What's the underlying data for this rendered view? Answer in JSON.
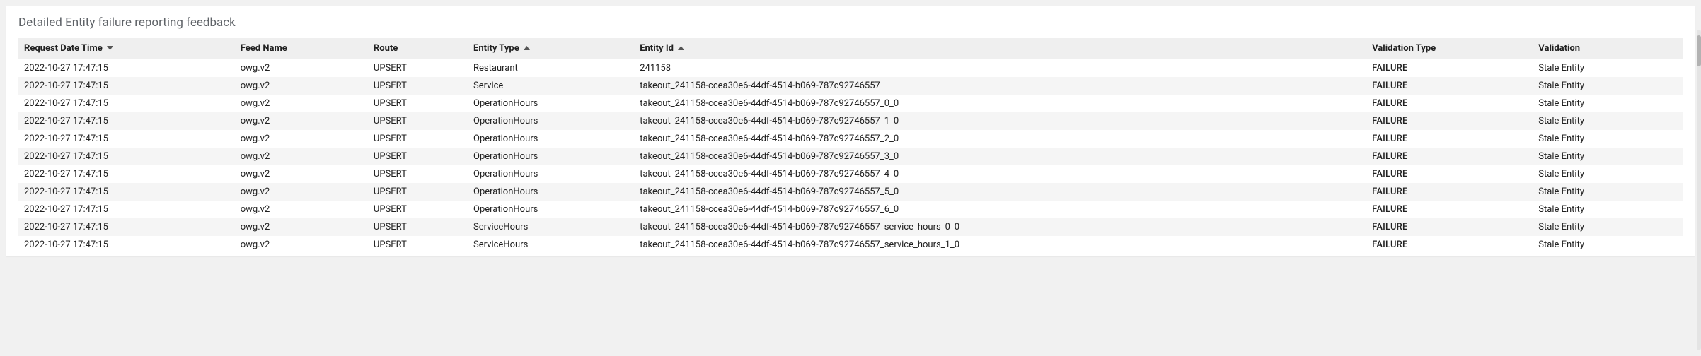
{
  "title": "Detailed Entity failure reporting feedback",
  "columns": {
    "request_date_time": "Request Date Time",
    "feed_name": "Feed Name",
    "route": "Route",
    "entity_type": "Entity Type",
    "entity_id": "Entity Id",
    "validation_type": "Validation Type",
    "validation": "Validation"
  },
  "sort": {
    "request_date_time": "desc",
    "entity_type": "asc",
    "entity_id": "asc"
  },
  "failure_style_label": "FAILURE",
  "rows": [
    {
      "request_date_time": "2022-10-27 17:47:15",
      "feed_name": "owg.v2",
      "route": "UPSERT",
      "entity_type": "Restaurant",
      "entity_id": "241158",
      "validation_type": "FAILURE",
      "validation": "Stale Entity"
    },
    {
      "request_date_time": "2022-10-27 17:47:15",
      "feed_name": "owg.v2",
      "route": "UPSERT",
      "entity_type": "Service",
      "entity_id": "takeout_241158-ccea30e6-44df-4514-b069-787c92746557",
      "validation_type": "FAILURE",
      "validation": "Stale Entity"
    },
    {
      "request_date_time": "2022-10-27 17:47:15",
      "feed_name": "owg.v2",
      "route": "UPSERT",
      "entity_type": "OperationHours",
      "entity_id": "takeout_241158-ccea30e6-44df-4514-b069-787c92746557_0_0",
      "validation_type": "FAILURE",
      "validation": "Stale Entity"
    },
    {
      "request_date_time": "2022-10-27 17:47:15",
      "feed_name": "owg.v2",
      "route": "UPSERT",
      "entity_type": "OperationHours",
      "entity_id": "takeout_241158-ccea30e6-44df-4514-b069-787c92746557_1_0",
      "validation_type": "FAILURE",
      "validation": "Stale Entity"
    },
    {
      "request_date_time": "2022-10-27 17:47:15",
      "feed_name": "owg.v2",
      "route": "UPSERT",
      "entity_type": "OperationHours",
      "entity_id": "takeout_241158-ccea30e6-44df-4514-b069-787c92746557_2_0",
      "validation_type": "FAILURE",
      "validation": "Stale Entity"
    },
    {
      "request_date_time": "2022-10-27 17:47:15",
      "feed_name": "owg.v2",
      "route": "UPSERT",
      "entity_type": "OperationHours",
      "entity_id": "takeout_241158-ccea30e6-44df-4514-b069-787c92746557_3_0",
      "validation_type": "FAILURE",
      "validation": "Stale Entity"
    },
    {
      "request_date_time": "2022-10-27 17:47:15",
      "feed_name": "owg.v2",
      "route": "UPSERT",
      "entity_type": "OperationHours",
      "entity_id": "takeout_241158-ccea30e6-44df-4514-b069-787c92746557_4_0",
      "validation_type": "FAILURE",
      "validation": "Stale Entity"
    },
    {
      "request_date_time": "2022-10-27 17:47:15",
      "feed_name": "owg.v2",
      "route": "UPSERT",
      "entity_type": "OperationHours",
      "entity_id": "takeout_241158-ccea30e6-44df-4514-b069-787c92746557_5_0",
      "validation_type": "FAILURE",
      "validation": "Stale Entity"
    },
    {
      "request_date_time": "2022-10-27 17:47:15",
      "feed_name": "owg.v2",
      "route": "UPSERT",
      "entity_type": "OperationHours",
      "entity_id": "takeout_241158-ccea30e6-44df-4514-b069-787c92746557_6_0",
      "validation_type": "FAILURE",
      "validation": "Stale Entity"
    },
    {
      "request_date_time": "2022-10-27 17:47:15",
      "feed_name": "owg.v2",
      "route": "UPSERT",
      "entity_type": "ServiceHours",
      "entity_id": "takeout_241158-ccea30e6-44df-4514-b069-787c92746557_service_hours_0_0",
      "validation_type": "FAILURE",
      "validation": "Stale Entity"
    },
    {
      "request_date_time": "2022-10-27 17:47:15",
      "feed_name": "owg.v2",
      "route": "UPSERT",
      "entity_type": "ServiceHours",
      "entity_id": "takeout_241158-ccea30e6-44df-4514-b069-787c92746557_service_hours_1_0",
      "validation_type": "FAILURE",
      "validation": "Stale Entity"
    }
  ]
}
